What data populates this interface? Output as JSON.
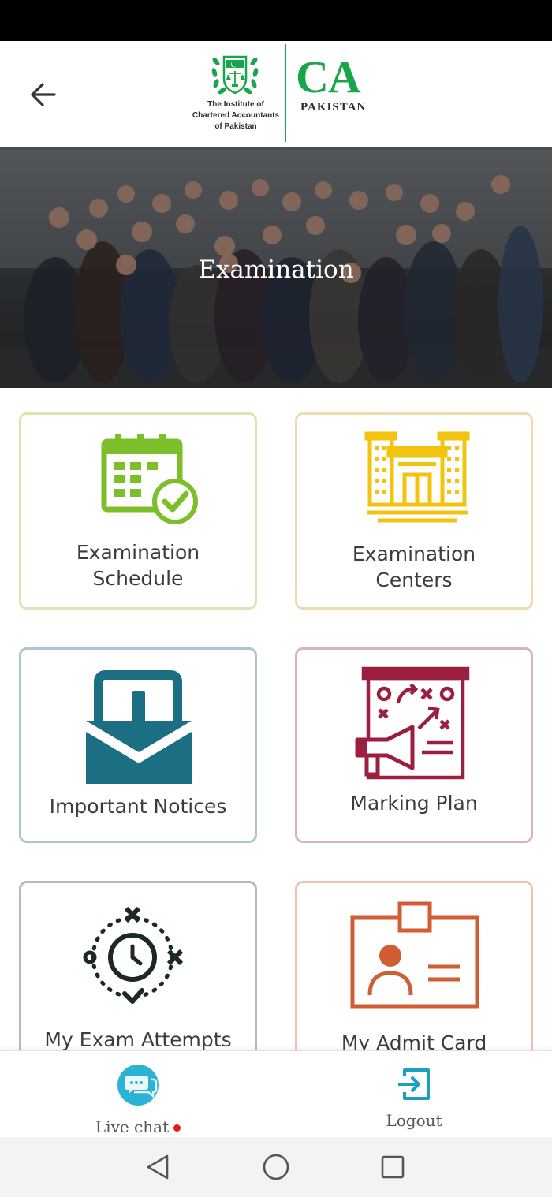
{
  "header": {
    "back_label": "Back",
    "institute_line1": "The Institute of",
    "institute_line2": "Chartered Accountants",
    "institute_line3": "of Pakistan",
    "brand_mark": "CA",
    "brand_sub": "PAKISTAN",
    "brand_color": "#1aa54a"
  },
  "hero": {
    "title": "Examination"
  },
  "tiles": [
    {
      "line1": "Examination",
      "line2": "Schedule",
      "icon": "calendar-check-icon",
      "color": "#7cbf2a",
      "border": "#dfe3b4"
    },
    {
      "line1": "Examination",
      "line2": "Centers",
      "icon": "building-icon",
      "color": "#f2c40f",
      "border": "#ecdcae"
    },
    {
      "line1": "Important Notices",
      "icon": "notice-envelope-icon",
      "color": "#1c6e82",
      "border": "#a9c7cf"
    },
    {
      "line1": "Marking Plan",
      "icon": "strategy-board-icon",
      "color": "#9c1f3f",
      "border": "#d9b2c2"
    },
    {
      "line1": "My Exam Attempts",
      "icon": "clock-attempts-icon",
      "color": "#1d2a22",
      "border": "#b3bbb8"
    },
    {
      "line1": "My Admit Card",
      "icon": "id-card-icon",
      "color": "#d05d34",
      "border": "#edc3b4"
    }
  ],
  "bottom_nav": {
    "live_chat": "Live chat",
    "logout": "Logout",
    "chat_color": "#2bb3d6",
    "logout_color": "#1a9fbf",
    "unread_dot_color": "#e01b1b"
  }
}
